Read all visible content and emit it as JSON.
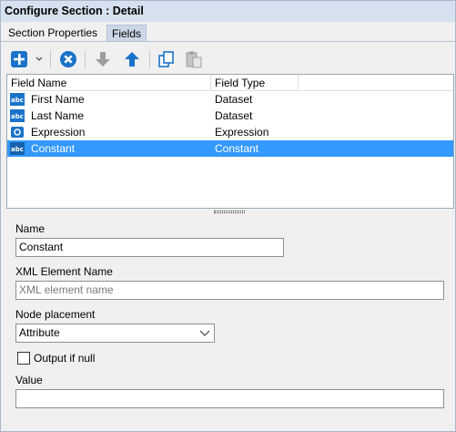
{
  "window": {
    "title": "Configure Section : Detail"
  },
  "tabs": [
    {
      "label": "Section Properties",
      "active": false
    },
    {
      "label": "Fields",
      "active": true
    }
  ],
  "toolbar": {
    "icons": [
      "add-icon",
      "dropdown-arrow-icon",
      "delete-icon",
      "move-down-icon",
      "move-up-icon",
      "copy-icon",
      "paste-icon"
    ]
  },
  "grid": {
    "columns": [
      "Field Name",
      "Field Type"
    ],
    "rows": [
      {
        "icon": "abc-icon",
        "name": "First Name",
        "type": "Dataset",
        "selected": false
      },
      {
        "icon": "abc-icon",
        "name": "Last Name",
        "type": "Dataset",
        "selected": false
      },
      {
        "icon": "expression-icon",
        "name": "Expression",
        "type": "Expression",
        "selected": false
      },
      {
        "icon": "abc-icon",
        "name": "Constant",
        "type": "Constant",
        "selected": true
      }
    ]
  },
  "form": {
    "name_label": "Name",
    "name_value": "Constant",
    "xml_label": "XML Element Name",
    "xml_placeholder": "XML element name",
    "node_label": "Node placement",
    "node_value": "Attribute",
    "output_null_label": "Output if null",
    "output_null_checked": false,
    "value_label": "Value",
    "value_value": ""
  },
  "colors": {
    "selection": "#3399ff",
    "titlebar": "#d6e1ef",
    "icon_blue": "#1a73c8"
  }
}
